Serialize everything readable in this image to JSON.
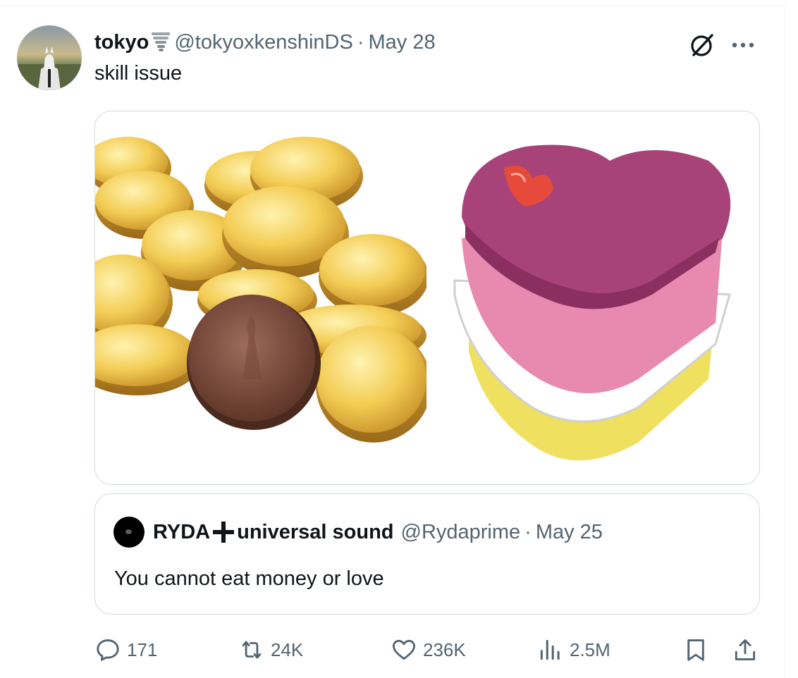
{
  "tweet": {
    "display_name": "tokyo",
    "name_emoji": "tornado-emoji",
    "handle": "@tokyoxkenshinDS",
    "separator": "·",
    "date": "May 28",
    "text": "skill issue",
    "media": [
      "chocolate-coins-image",
      "heart-cake-image"
    ]
  },
  "quote": {
    "display_name_part1": "RYDA",
    "display_name_part2": "universal sound",
    "handle": "@Rydaprime",
    "separator": "·",
    "date": "May 25",
    "text": "You cannot eat money or love"
  },
  "actions": {
    "replies": "171",
    "reposts": "24K",
    "likes": "236K",
    "views": "2.5M"
  },
  "icons": [
    "grok-icon",
    "more-icon",
    "reply-icon",
    "repost-icon",
    "like-icon",
    "views-icon",
    "bookmark-icon",
    "share-icon"
  ],
  "colors": {
    "text_primary": "#0f1419",
    "text_secondary": "#536471",
    "border": "#cfd9de"
  }
}
